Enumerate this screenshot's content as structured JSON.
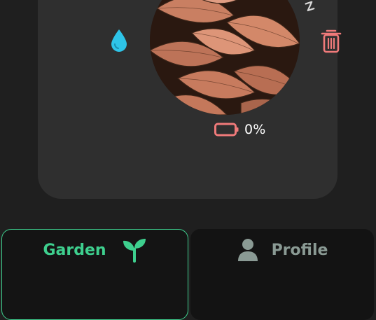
{
  "plant": {
    "battery_level": "0%",
    "icons": {
      "water": "water-drop-icon",
      "sleep": "sleep-zzz-icon",
      "delete": "trash-icon",
      "battery": "battery-empty-icon"
    },
    "status": "sleeping"
  },
  "nav": {
    "tabs": [
      {
        "label": "Garden",
        "icon": "sprout-icon",
        "active": true
      },
      {
        "label": "Profile",
        "icon": "user-icon",
        "active": false
      }
    ]
  },
  "colors": {
    "background": "#1f1f1f",
    "card": "#2f2f2f",
    "accent_green": "#3ecf8e",
    "water_blue": "#2ec4e8",
    "danger_red": "#f07a7a",
    "inactive_gray": "#8a9a94",
    "photo_tint": "#d68a6b"
  }
}
